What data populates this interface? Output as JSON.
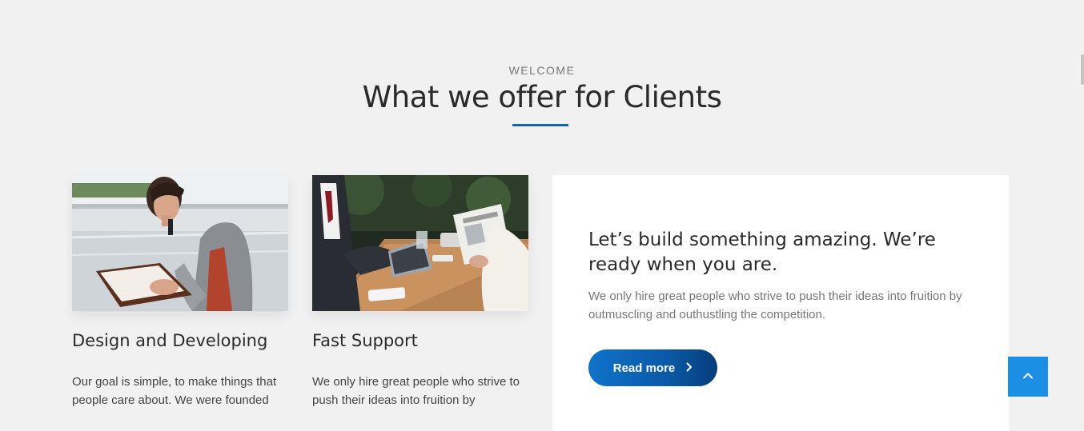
{
  "header": {
    "eyebrow": "WELCOME",
    "title": "What we offer for Clients"
  },
  "cards": [
    {
      "title": "Design and Developing",
      "text": "Our goal is simple, to make things that people care about. We were founded",
      "image": "woman-on-phone-photo"
    },
    {
      "title": "Fast Support",
      "text": "We only hire great people who strive to push their ideas into fruition by",
      "image": "business-meeting-photo"
    }
  ],
  "promo": {
    "title": "Let’s build something amazing. We’re ready when you are.",
    "text": "We only hire great people who strive to push their ideas into fruition by outmuscling and outhustling the competition.",
    "button_label": "Read more",
    "button_icon": "chevron-right-icon"
  },
  "back_to_top": {
    "icon": "chevron-up-icon"
  },
  "colors": {
    "accent": "#1561b3",
    "button_start": "#0f73c9",
    "button_end": "#073d7a",
    "back_to_top": "#1a8fe3",
    "background": "#f1f1f1"
  }
}
